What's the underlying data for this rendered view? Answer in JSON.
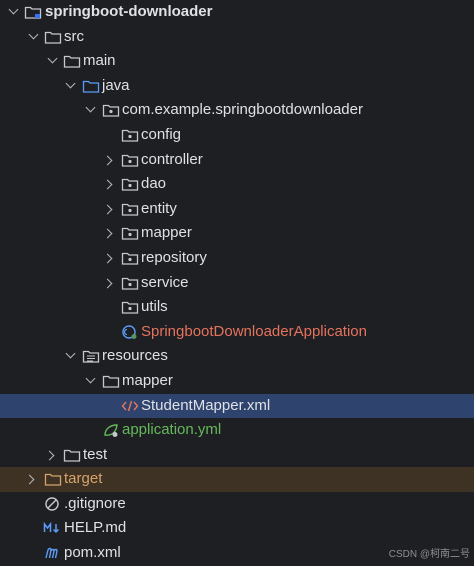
{
  "project_tree": {
    "root": "springboot-downloader",
    "src": "src",
    "main": "main",
    "java": "java",
    "package": "com.example.springbootdownloader",
    "packages": {
      "config": "config",
      "controller": "controller",
      "dao": "dao",
      "entity": "entity",
      "mapper": "mapper",
      "repository": "repository",
      "service": "service",
      "utils": "utils"
    },
    "application_class": "SpringbootDownloaderApplication",
    "resources": "resources",
    "resources_mapper": "mapper",
    "student_mapper": "StudentMapper.xml",
    "application_yml": "application.yml",
    "test": "test",
    "target": "target",
    "gitignore": ".gitignore",
    "help_md": "HELP.md",
    "pom": "pom.xml"
  },
  "colors": {
    "selection": "#2e436e",
    "excluded_row": "#3d3223",
    "class_text": "#e4735d",
    "yml_text": "#65b85b",
    "target_text": "#d7a36b"
  },
  "watermark": "CSDN @柯南二号"
}
